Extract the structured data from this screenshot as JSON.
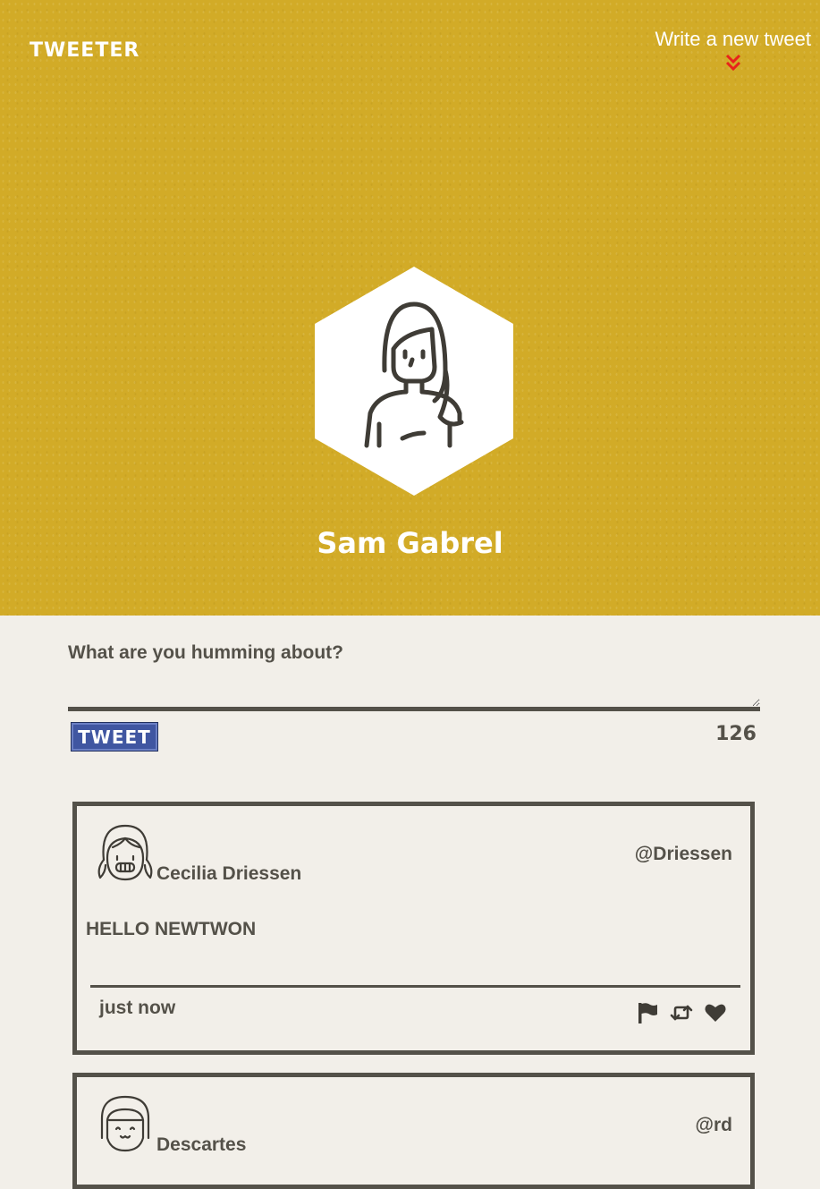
{
  "app": {
    "brand": "TWEETER"
  },
  "nav": {
    "write_link": "Write a new tweet"
  },
  "profile": {
    "name": "Sam Gabrel"
  },
  "composer": {
    "label": "What are you humming about?",
    "value": "",
    "button_label": "TWEET",
    "remaining_chars": "126"
  },
  "colors": {
    "hero_bg": "#d2ab27",
    "page_bg": "#f2efe9",
    "text": "#545149",
    "button": "#4056a1",
    "chevron": "#e8231b"
  },
  "tweets": [
    {
      "name": "Cecilia Driessen",
      "handle": "@Driessen",
      "content": "HELLO NEWTWON",
      "time": "just now",
      "avatar_icon": "girl-avatar-icon"
    },
    {
      "name": "Descartes",
      "handle": "@rd",
      "content": "",
      "time": "",
      "avatar_icon": "girl-avatar-icon"
    }
  ]
}
